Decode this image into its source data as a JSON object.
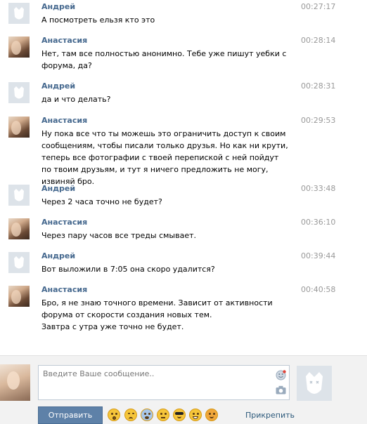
{
  "messages": [
    {
      "author": "Андрей",
      "time": "00:27:17",
      "lines": [
        "А посмотреть ельзя кто это"
      ]
    },
    {
      "author": "Анастасия",
      "time": "00:28:14",
      "lines": [
        "Нет, там все полностью анонимно. Тебе уже пишут уебки с форума, да?"
      ]
    },
    {
      "author": "Андрей",
      "time": "00:28:31",
      "lines": [
        "да и что делать?"
      ]
    },
    {
      "author": "Анастасия",
      "time": "00:29:53",
      "lines": [
        "Ну пока все что ты можешь это ограничить доступ к своим сообщениям, чтобы писали только друзья. Но как ни крути, теперь все фотографии с твоей перепиской с ней пойдут по твоим друзьям, и тут я ничего предложить не могу, извиняй бро."
      ]
    },
    {
      "author": "Андрей",
      "time": "00:33:48",
      "lines": [
        "Через 2 часа точно не будет?"
      ]
    },
    {
      "author": "Анастасия",
      "time": "00:36:10",
      "lines": [
        "Через пару часов все треды смывает."
      ]
    },
    {
      "author": "Андрей",
      "time": "00:39:44",
      "lines": [
        "Вот выложили в 7:05 она скоро удалится?"
      ]
    },
    {
      "author": "Анастасия",
      "time": "00:40:58",
      "lines": [
        "Бро, я не знаю точного времени. Зависит от активности форума от скорости создания новых тем.",
        "Завтра с утра уже точно не будет."
      ]
    }
  ],
  "composer": {
    "placeholder": "Введите Ваше сообщение..",
    "send_label": "Отправить",
    "attach_label": "Прикрепить",
    "emojis": [
      "flushed-emoji",
      "unamused-emoji",
      "fearful-emoji",
      "neutral-emoji",
      "sunglasses-emoji",
      "grinning-emoji",
      "blush-emoji"
    ]
  },
  "colors": {
    "author": "#45688e",
    "time": "#999999",
    "send_button": "#5e81a8",
    "link": "#2b587a",
    "composer_bg": "#f2f2f2"
  }
}
